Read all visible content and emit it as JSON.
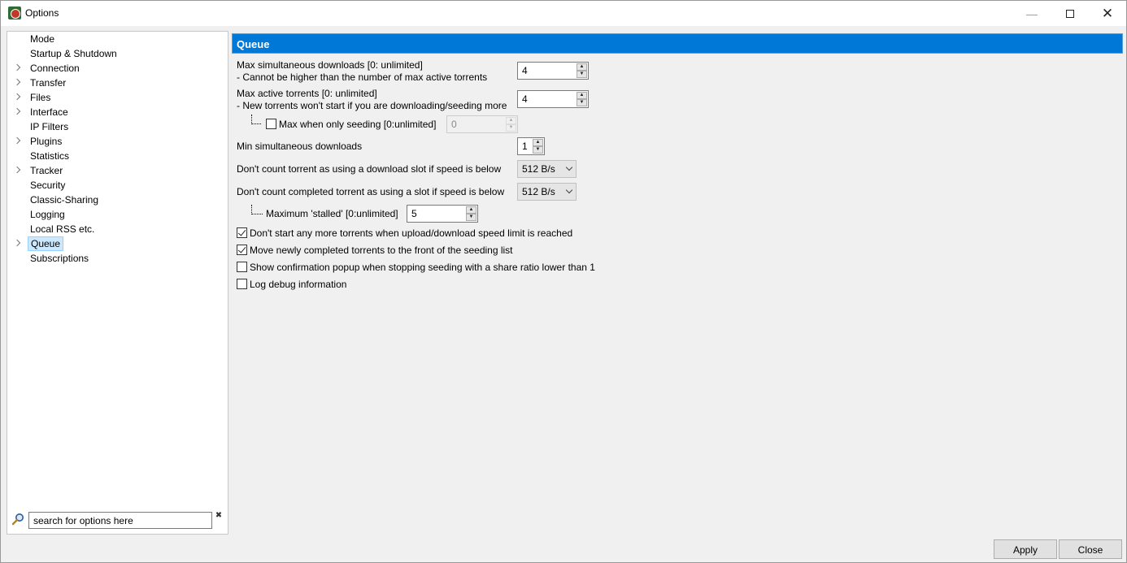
{
  "window": {
    "title": "Options"
  },
  "title_controls": {
    "minimize": "—",
    "close": "✕"
  },
  "sidebar": {
    "items": [
      {
        "label": "Mode",
        "expandable": false
      },
      {
        "label": "Startup & Shutdown",
        "expandable": false
      },
      {
        "label": "Connection",
        "expandable": true
      },
      {
        "label": "Transfer",
        "expandable": true
      },
      {
        "label": "Files",
        "expandable": true
      },
      {
        "label": "Interface",
        "expandable": true
      },
      {
        "label": "IP Filters",
        "expandable": false
      },
      {
        "label": "Plugins",
        "expandable": true
      },
      {
        "label": "Statistics",
        "expandable": false
      },
      {
        "label": "Tracker",
        "expandable": true
      },
      {
        "label": "Security",
        "expandable": false
      },
      {
        "label": "Classic-Sharing",
        "expandable": false
      },
      {
        "label": "Logging",
        "expandable": false
      },
      {
        "label": "Local RSS etc.",
        "expandable": false
      },
      {
        "label": "Queue",
        "expandable": true,
        "selected": true
      },
      {
        "label": "Subscriptions",
        "expandable": false
      }
    ],
    "search": {
      "value": "search for options here",
      "clear": "✖"
    }
  },
  "queue": {
    "header": "Queue",
    "max_downloads": {
      "label": "Max simultaneous downloads [0: unlimited]",
      "hint": " - Cannot be higher than the number of max active torrents",
      "value": "4"
    },
    "max_active": {
      "label": "Max active torrents [0: unlimited]",
      "hint": " - New torrents won't start if you are downloading/seeding more",
      "value": "4"
    },
    "max_seeding": {
      "label": "Max when only seeding [0:unlimited]",
      "value": "0",
      "checked": false,
      "enabled": false
    },
    "min_downloads": {
      "label": "Min simultaneous downloads",
      "value": "1"
    },
    "download_slot": {
      "label": "Don't count torrent as using a download slot if speed is below",
      "value": "512 B/s"
    },
    "completed_slot": {
      "label": "Don't count completed torrent as using a slot if speed is below",
      "value": "512 B/s"
    },
    "max_stalled": {
      "label": "Maximum 'stalled' [0:unlimited]",
      "value": "5"
    },
    "options": [
      {
        "label": "Don't start any more torrents when upload/download speed limit is reached",
        "checked": true
      },
      {
        "label": "Move newly completed torrents to the front of the seeding list",
        "checked": true
      },
      {
        "label": "Show confirmation popup when stopping seeding with a share ratio lower than 1",
        "checked": false
      },
      {
        "label": "Log debug information",
        "checked": false
      }
    ]
  },
  "footer": {
    "apply": "Apply",
    "close": "Close"
  },
  "spin_arrows": {
    "up": "▲",
    "down": "▼"
  }
}
